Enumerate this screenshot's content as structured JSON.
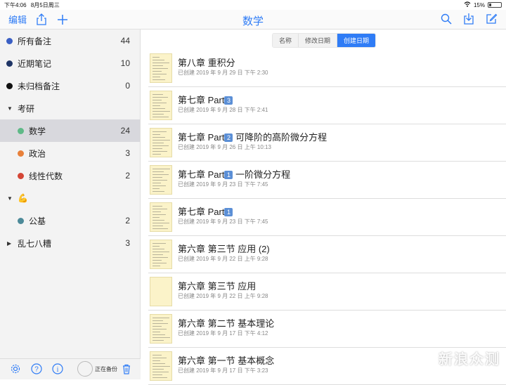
{
  "status_bar": {
    "time": "下午4:06",
    "date": "8月5日周三",
    "battery": "15%"
  },
  "nav": {
    "edit_label": "编辑",
    "title": "数学"
  },
  "colors": {
    "accent": "#2f7cf6",
    "blue": "#3a5fc4",
    "navy": "#1f3566",
    "black": "#111111",
    "green": "#5fb987",
    "orange": "#e8803a",
    "red": "#d44636",
    "teal": "#4d8a99"
  },
  "sidebar": {
    "items": [
      {
        "label": "所有备注",
        "count": "44"
      },
      {
        "label": "近期笔记",
        "count": "10"
      },
      {
        "label": "未归档备注",
        "count": "0"
      },
      {
        "label": "考研"
      },
      {
        "label": "数学",
        "count": "24"
      },
      {
        "label": "政治",
        "count": "3"
      },
      {
        "label": "线性代数",
        "count": "2"
      },
      {
        "label": "💪"
      },
      {
        "label": "公基",
        "count": "2"
      },
      {
        "label": "乱七八糟",
        "count": "3"
      }
    ],
    "backup_text": "正在备份"
  },
  "sort": {
    "options": [
      "名称",
      "修改日期",
      "创建日期"
    ],
    "selected": "创建日期"
  },
  "notes": [
    {
      "title": "第八章 重积分",
      "date": "已创建 2019 年 9 月 29 日 下午 2:30"
    },
    {
      "title": "第七章 Part",
      "badge": "3",
      "suffix": "",
      "date": "已创建 2019 年 9 月 28 日 下午 2:41"
    },
    {
      "title": "第七章 Part",
      "badge": "2",
      "suffix": " 可降阶的高阶微分方程",
      "date": "已创建 2019 年 9 月 26 日 上午 10:13"
    },
    {
      "title": "第七章 Part",
      "badge": "1",
      "suffix": " 一阶微分方程",
      "date": "已创建 2019 年 9 月 23 日 下午 7:45"
    },
    {
      "title": "第七章 Part",
      "badge": "1",
      "suffix": "",
      "date": "已创建 2019 年 9 月 23 日 下午 7:45"
    },
    {
      "title": "第六章 第三节 应用 (2)",
      "date": "已创建 2019 年 9 月 22 日 上午 9:28"
    },
    {
      "title": "第六章 第三节 应用",
      "date": "已创建 2019 年 9 月 22 日 上午 9:28"
    },
    {
      "title": "第六章 第二节 基本理论",
      "date": "已创建 2019 年 9 月 17 日 下午 4:12"
    },
    {
      "title": "第六章 第一节 基本概念",
      "date": "已创建 2019 年 9 月 17 日 下午 3:23"
    }
  ],
  "watermark": "新浪众测"
}
